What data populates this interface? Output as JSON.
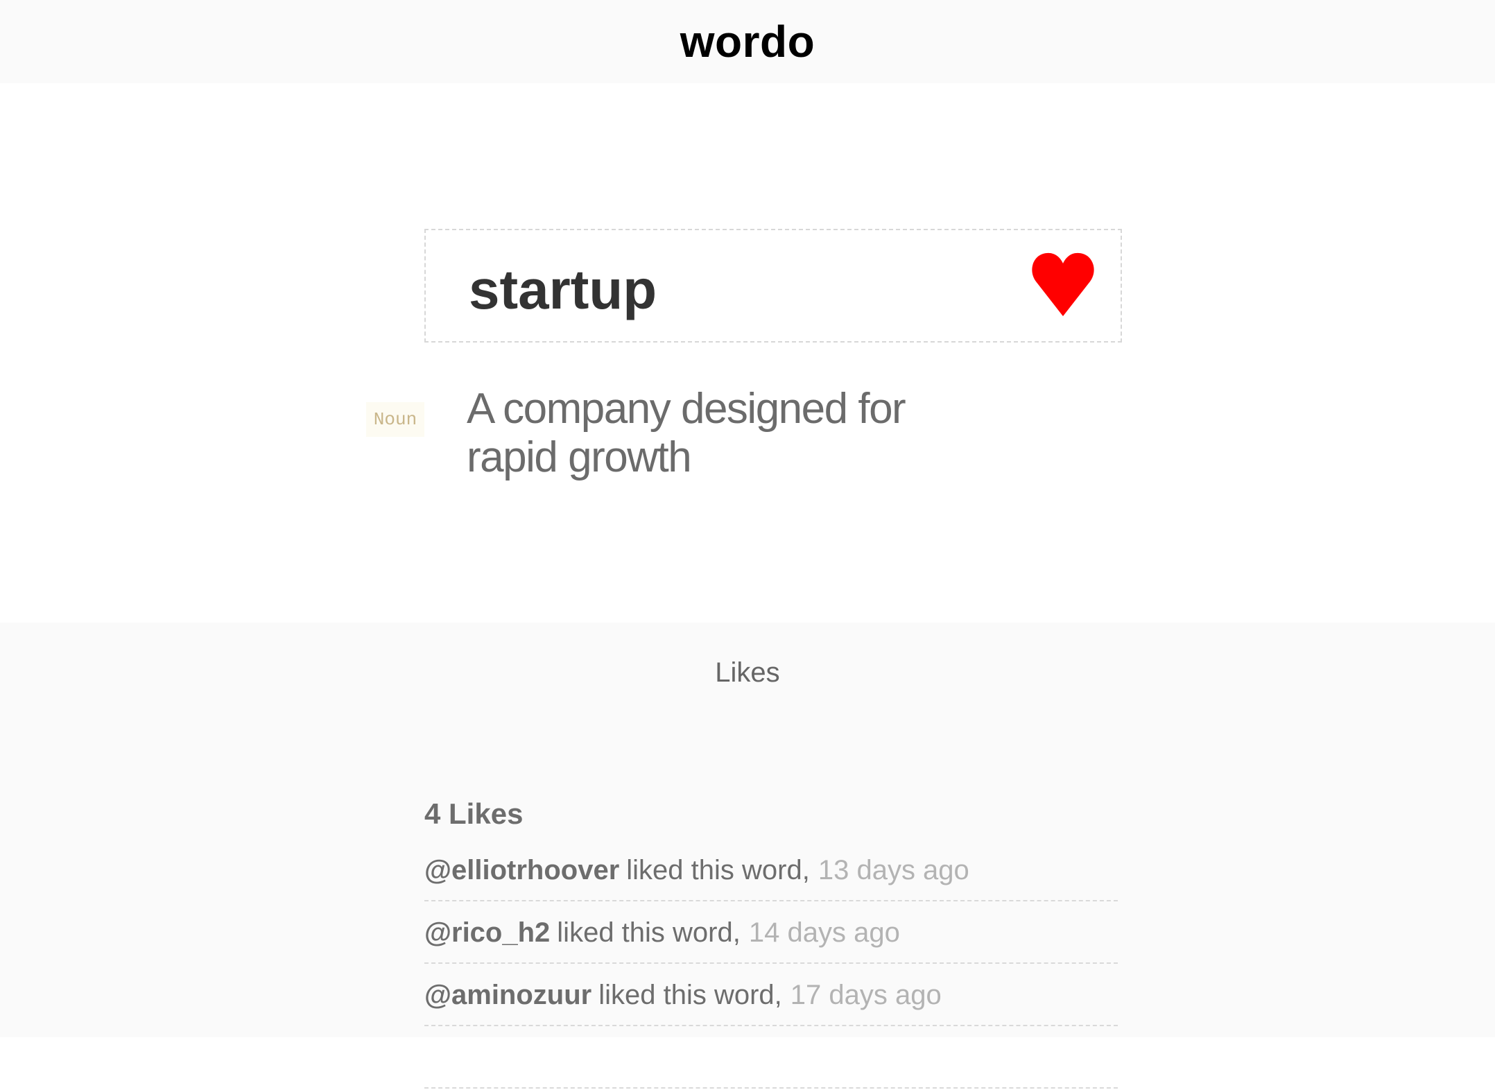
{
  "header": {
    "brand": "wordo"
  },
  "word": {
    "title": "startup",
    "like_icon": "heart-icon",
    "like_color": "#ff0000",
    "part_of_speech": "Noun",
    "definition": "A company designed for rapid growth"
  },
  "likes": {
    "heading": "Likes",
    "count_label": "4 Likes",
    "items": [
      {
        "user": "@elliotrhoover",
        "text": "liked this word,",
        "time": "13 days ago"
      },
      {
        "user": "@rico_h2",
        "text": "liked this word,",
        "time": "14 days ago"
      },
      {
        "user": "@aminozuur",
        "text": "liked this word,",
        "time": "17 days ago"
      },
      {
        "user": "",
        "text": "",
        "time": ""
      }
    ]
  }
}
